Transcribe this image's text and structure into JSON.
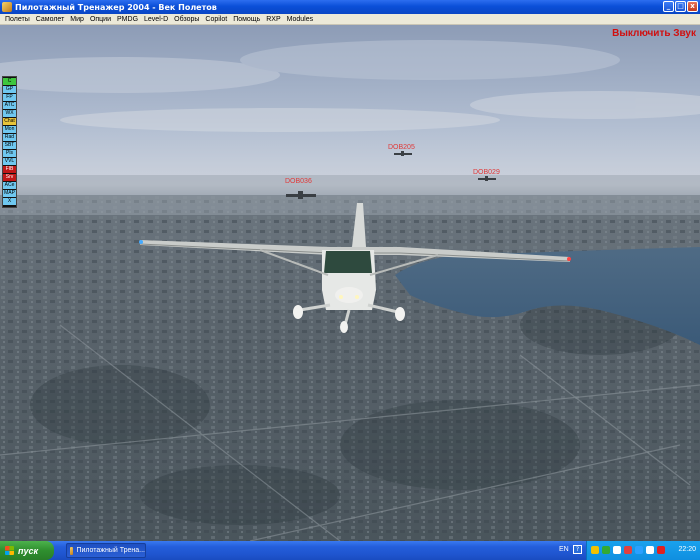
{
  "window": {
    "title": "Пилотажный Тренажер 2004 - Век Полетов",
    "controls": [
      "_",
      "□",
      "x"
    ]
  },
  "menu": {
    "items": [
      "Полеты",
      "Самолет",
      "Мир",
      "Опции",
      "PMDG",
      "Level-D",
      "Обзоры",
      "Copilot",
      "Помощь",
      "RXP",
      "Modules"
    ]
  },
  "viewport": {
    "sound_toggle": "Выключить Звук",
    "traffic": [
      {
        "callsign": "DOB205"
      },
      {
        "callsign": "DOB036"
      },
      {
        "callsign": "DOB029"
      }
    ]
  },
  "panel": {
    "buttons": [
      {
        "label": "C",
        "color": "#3ec63e"
      },
      {
        "label": "GP",
        "color": "#6fc8f0"
      },
      {
        "label": "FP",
        "color": "#6fc8f0"
      },
      {
        "label": "ATC",
        "color": "#6fc8f0"
      },
      {
        "label": "WX",
        "color": "#6fc8f0"
      },
      {
        "label": "Chat",
        "color": "#e8c43a"
      },
      {
        "label": "Mon",
        "color": "#6fc8f0"
      },
      {
        "label": "Rad",
        "color": "#6fc8f0"
      },
      {
        "label": "SBT",
        "color": "#6fc8f0"
      },
      {
        "label": "Pls",
        "color": "#6fc8f0"
      },
      {
        "label": "VVL",
        "color": "#6fc8f0"
      },
      {
        "label": "FIB",
        "color": "#c01818"
      },
      {
        "label": "Srv",
        "color": "#c01818"
      },
      {
        "label": "ACe",
        "color": "#6fc8f0"
      },
      {
        "label": "MAP",
        "color": "#6fc8f0"
      },
      {
        "label": "X",
        "color": "#6fc8f0"
      }
    ]
  },
  "taskbar": {
    "start_label": "пуск",
    "task_label": "Пилотажный Трена...",
    "language": "EN",
    "help": "?",
    "clock": "22:20",
    "tray_colors": [
      "#f2c200",
      "#33aa33",
      "#ffffff",
      "#e04040",
      "#2aa0ff",
      "#ffffff",
      "#e02020"
    ]
  }
}
